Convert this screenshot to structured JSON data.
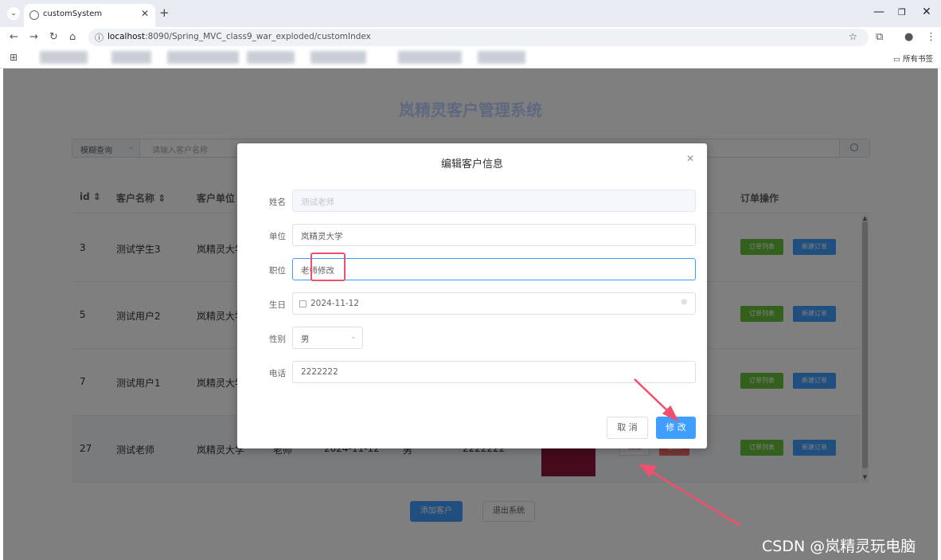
{
  "browser": {
    "tab_title": "customSystem",
    "url_host": "localhost",
    "url_rest": ":8090/Spring_MVC_class9_war_exploded/customIndex",
    "bookmarks_folder": "所有书签",
    "icons": [
      "chevron-down-icon",
      "globe-icon",
      "close-icon",
      "plus-icon",
      "back-icon",
      "forward-icon",
      "reload-icon",
      "home-icon",
      "info-icon",
      "star-icon",
      "extensions-icon",
      "profile-icon",
      "menu-icon",
      "apps-icon",
      "folder-icon"
    ]
  },
  "page": {
    "title": "岚精灵客户管理系统",
    "search": {
      "mode": "模糊查询",
      "placeholder": "请输入客户名称"
    },
    "table": {
      "headers": {
        "id": "id",
        "name": "客户名称",
        "company": "客户单位",
        "orders": "订单操作"
      },
      "rows": [
        {
          "id": "3",
          "name": "测试学生3",
          "company": "岚精灵大学"
        },
        {
          "id": "5",
          "name": "测试用户2",
          "company": "岚精灵大学"
        },
        {
          "id": "7",
          "name": "测试用户1",
          "company": "岚精灵大学"
        },
        {
          "id": "27",
          "name": "测试老师",
          "company": "岚精灵大学",
          "position": "老师",
          "birthday": "2024-11-12",
          "gender": "男",
          "phone": "2222222"
        }
      ],
      "order_list_label": "订单列表",
      "new_order_label": "新建订单",
      "edit_label": "编辑",
      "delete_label": "删除"
    },
    "add_customer_label": "添加客户",
    "exit_label": "退出系统"
  },
  "dialog": {
    "title": "编辑客户信息",
    "fields": {
      "name_label": "姓名",
      "name_value": "测试老师",
      "company_label": "单位",
      "company_value": "岚精灵大学",
      "position_label": "职位",
      "position_value": "老师修改",
      "birthday_label": "生日",
      "birthday_value": "2024-11-12",
      "gender_label": "性别",
      "gender_value": "男",
      "phone_label": "电话",
      "phone_value": "2222222"
    },
    "cancel_label": "取 消",
    "ok_label": "修 改"
  },
  "watermark": "CSDN @岚精灵玩电脑",
  "colors": {
    "primary": "#409eff",
    "success": "#67c23a",
    "danger": "#f56c6c",
    "annotation": "#f0506e"
  }
}
